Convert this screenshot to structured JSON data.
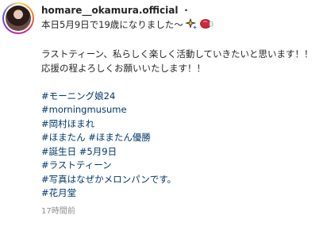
{
  "post": {
    "username": "homare__okamura.official",
    "separator": "・",
    "caption": {
      "line1": "本日5月9日で19歳になりました〜",
      "line2": "ラストティーン、私らしく楽しく活動していきたいと思います！！",
      "line3": "応援の程よろしくお願いいたします！！"
    },
    "hashtags": {
      "h1": "#モーニング娘24",
      "h2": "#morningmusume",
      "h3": "#岡村ほまれ",
      "h4a": "#ほまたん",
      "h4b": "#ほまたん優勝",
      "h5a": "#誕生日",
      "h5b": "#5月9日",
      "h6": "#ラストティーン",
      "h7": "#写真はなぜかメロンパンです。",
      "h8": "#花月堂"
    },
    "timestamp": "17時間前",
    "icons": [
      "avatar",
      "sparkle-emoji",
      "boxing-glove-emoji"
    ],
    "colors": {
      "hashtag": "#00376b",
      "text": "#262626",
      "muted": "#8e8e8e"
    }
  }
}
